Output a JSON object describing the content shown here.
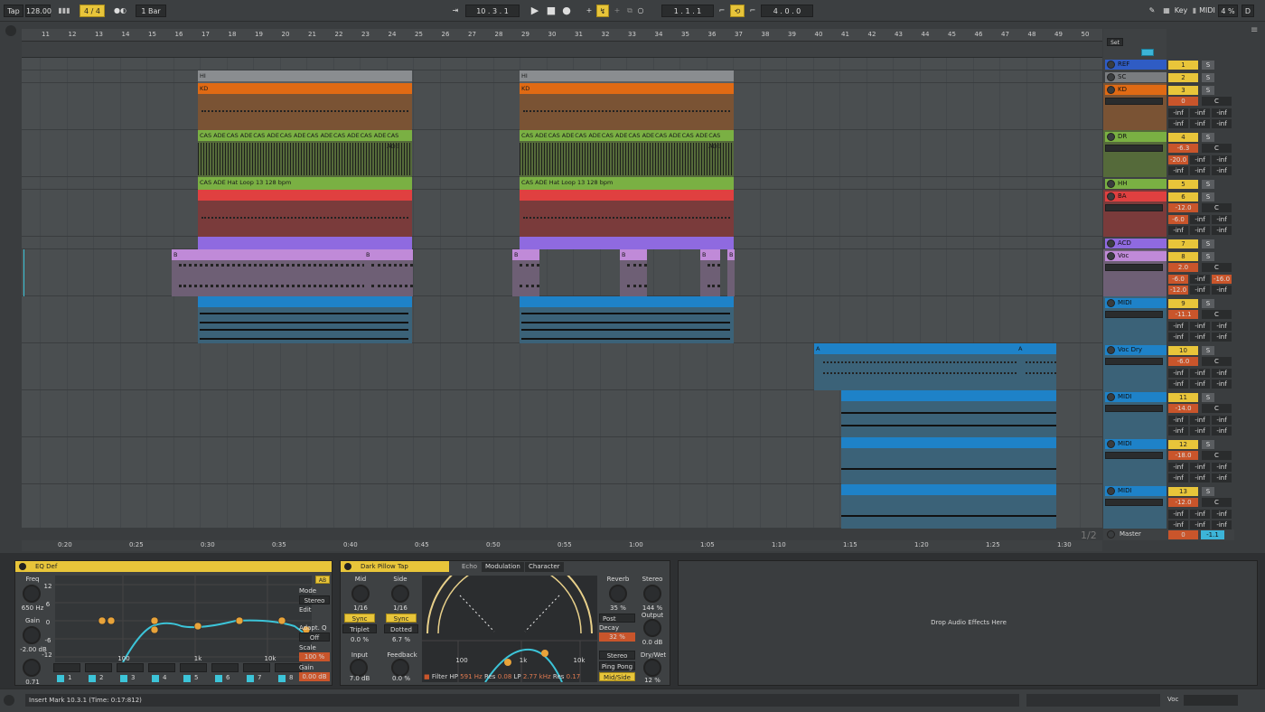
{
  "transport": {
    "tap": "Tap",
    "bpm": "128.00",
    "sig": "4 / 4",
    "quant": "1 Bar",
    "position": "10 .  3 .  1",
    "loop_start": "1 .  1 .  1",
    "loop_len": "4 .  0 .  0",
    "key": "Key",
    "midi": "MIDI",
    "cpu": "4 %",
    "d": "D"
  },
  "ruler": {
    "bars": [
      "11",
      "12",
      "13",
      "14",
      "15",
      "16",
      "17",
      "18",
      "19",
      "20",
      "21",
      "22",
      "23",
      "24",
      "25",
      "26",
      "27",
      "28",
      "29",
      "30",
      "31",
      "32",
      "33",
      "34",
      "35",
      "36",
      "37",
      "38",
      "39",
      "40",
      "41",
      "42",
      "43",
      "44",
      "45",
      "46",
      "47",
      "48",
      "49",
      "50"
    ],
    "set": "Set"
  },
  "timeline": {
    "times": [
      "0:20",
      "0:25",
      "0:30",
      "0:35",
      "0:40",
      "0:45",
      "0:50",
      "0:55",
      "1:00",
      "1:05",
      "1:10",
      "1:15",
      "1:20",
      "1:25",
      "1:30"
    ],
    "page": "1/2"
  },
  "clips": {
    "hi": "HI",
    "kd": "KD",
    "cas": "CAS ADE",
    "hat": "CAS ADE Hat Loop 13 128 bpm",
    "b": "B",
    "a": "A"
  },
  "tracks": [
    {
      "name": "REF",
      "color": "#2f5cc4",
      "num": "1",
      "vol": "",
      "pan": "",
      "send1": "",
      "send2": "",
      "send3": ""
    },
    {
      "name": "SC",
      "color": "#7a7d80",
      "num": "2",
      "vol": "",
      "pan": "",
      "send1": "",
      "send2": "",
      "send3": ""
    },
    {
      "name": "KD",
      "color": "#e06a14",
      "num": "3",
      "vol": "0",
      "pan": "C",
      "send1": "-inf",
      "send2": "-inf",
      "send3": "-inf"
    },
    {
      "name": "DR",
      "color": "#7ab043",
      "num": "4",
      "vol": "-6.3",
      "pan": "C",
      "send1": "-20.0",
      "send2": "-inf",
      "send3": "-inf"
    },
    {
      "name": "HH",
      "color": "#7ab043",
      "num": "5",
      "vol": "",
      "pan": "",
      "send1": "",
      "send2": "",
      "send3": ""
    },
    {
      "name": "BA",
      "color": "#e04040",
      "num": "6",
      "vol": "-12.0",
      "pan": "C",
      "send1": "-6.0",
      "send2": "-inf",
      "send3": "-inf"
    },
    {
      "name": "ACD",
      "color": "#8f6ae0",
      "num": "7",
      "vol": "",
      "pan": "",
      "send1": "",
      "send2": "",
      "send3": ""
    },
    {
      "name": "Voc",
      "color": "#c08ad8",
      "num": "8",
      "vol": "2.0",
      "pan": "C",
      "send1": "-6.0",
      "send2": "-inf",
      "send3": "-16.0",
      "send4": "-12.0",
      "send5": "-inf",
      "send6": "-inf"
    },
    {
      "name": "MIDI",
      "color": "#1e82c8",
      "num": "9",
      "vol": "-11.1",
      "pan": "C",
      "send1": "-inf",
      "send2": "-inf",
      "send3": "-inf"
    },
    {
      "name": "Voc Dry",
      "color": "#1e82c8",
      "num": "10",
      "vol": "-6.0",
      "pan": "C",
      "send1": "-inf",
      "send2": "-inf",
      "send3": "-inf"
    },
    {
      "name": "MIDI",
      "color": "#1e82c8",
      "num": "11",
      "vol": "-14.0",
      "pan": "C",
      "send1": "-inf",
      "send2": "-inf",
      "send3": "-inf"
    },
    {
      "name": "MIDI",
      "color": "#1e82c8",
      "num": "12",
      "vol": "-18.0",
      "pan": "C",
      "send1": "-inf",
      "send2": "-inf",
      "send3": "-inf"
    },
    {
      "name": "MIDI",
      "color": "#1e82c8",
      "num": "13",
      "vol": "-12.0",
      "pan": "C",
      "send1": "-inf",
      "send2": "-inf",
      "send3": "-inf"
    }
  ],
  "master": {
    "name": "Master",
    "vol": "0",
    "meter": "-1.1"
  },
  "eq": {
    "title": "EQ Def",
    "freq_label": "Freq",
    "freq": "650 Hz",
    "gain_label": "Gain",
    "gain": "-2.00 dB",
    "q_label": "Q",
    "q": "0.71",
    "mode_label": "Mode",
    "mode": "Stereo",
    "edit_label": "Edit",
    "adapt": "Adapt. Q",
    "adapt_val": "Off",
    "scale_label": "Scale",
    "scale": "100 %",
    "gain2_label": "Gain",
    "gain2": "0.00 dB",
    "db_ticks": [
      "12",
      "6",
      "0",
      "-6",
      "-12"
    ],
    "freq_ticks": [
      "100",
      "1k",
      "10k"
    ],
    "bands": [
      "1",
      "2",
      "3",
      "4",
      "5",
      "6",
      "7",
      "8"
    ],
    "ab": "AB"
  },
  "delay": {
    "title": "Dark Pillow Tap",
    "tabs": [
      "Echo",
      "Modulation",
      "Character"
    ],
    "mid": "Mid",
    "side": "Side",
    "mid_val": "1/16",
    "side_val": "1/16",
    "sync": "Sync",
    "triplet": "Triplet",
    "dotted": "Dotted",
    "off1": "0.0 %",
    "off2": "6.7 %",
    "input": "Input",
    "input_val": "7.0 dB",
    "feedback": "Feedback",
    "feedback_val": "0.0 %",
    "filter": "Filter",
    "hp": "HP",
    "hp_val": "591 Hz",
    "res": "Res",
    "res1": "0.08",
    "lp": "LP",
    "lp_val": "2.77 kHz",
    "res2": "0.17",
    "ticks": [
      "100",
      "1k",
      "10k"
    ],
    "reverb": "Reverb",
    "reverb_val": "35 %",
    "stereo": "Stereo",
    "stereo_val": "144 %",
    "post": "Post",
    "decay": "Decay",
    "decay_val": "32 %",
    "output": "Output",
    "output_val": "0.0 dB",
    "stereo_btn": "Stereo",
    "pingpong": "Ping Pong",
    "midside": "Mid/Side",
    "drywet": "Dry/Wet",
    "drywet_val": "12 %"
  },
  "drop": "Drop Audio Effects Here",
  "status": {
    "text": "Insert Mark 10.3.1 (Time: 0:17:812)",
    "track": "Voc"
  }
}
